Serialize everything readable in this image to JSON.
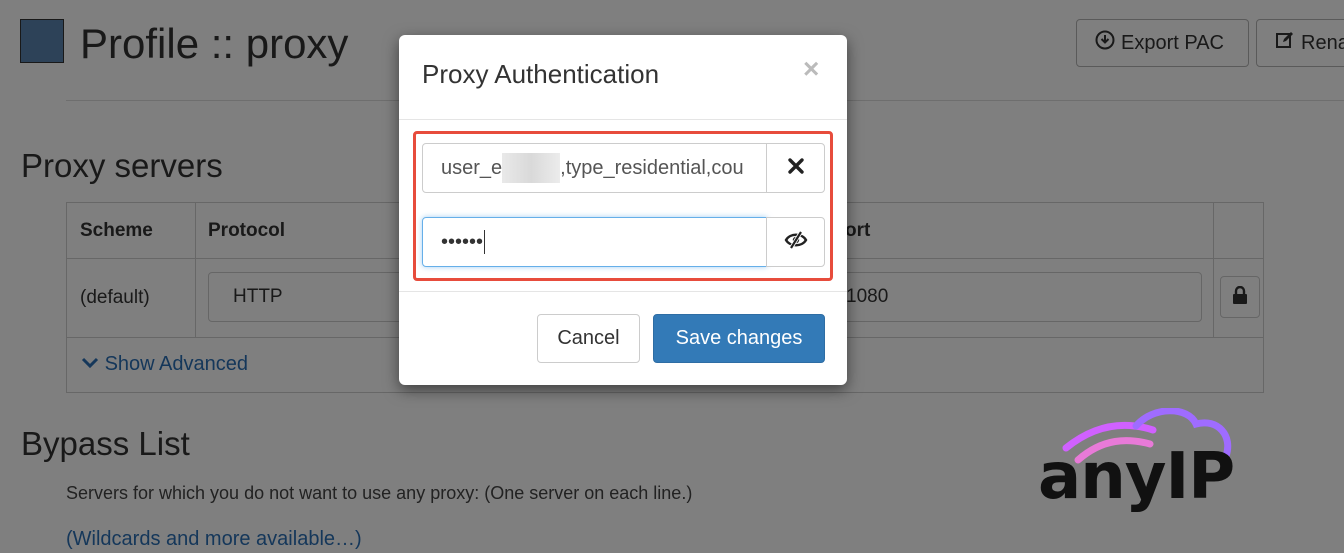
{
  "header": {
    "title": "Profile :: proxy",
    "export_pac_label": "Export PAC",
    "rename_label": "Rena",
    "swatch_color": "#5b84b1"
  },
  "proxy_servers": {
    "heading": "Proxy servers",
    "columns": [
      "Scheme",
      "Protocol",
      "ort"
    ],
    "row": {
      "scheme": "(default)",
      "protocol": "HTTP",
      "port": "1080"
    },
    "show_advanced_label": "Show Advanced"
  },
  "bypass": {
    "heading": "Bypass List",
    "description": "Servers for which you do not want to use any proxy: (One server on each line.)",
    "wildcards_link": "(Wildcards and more available…)"
  },
  "modal": {
    "title": "Proxy Authentication",
    "close_glyph": "×",
    "username_prefix": "user_e",
    "username_suffix": ",type_residential,cou",
    "password_masked": "••••••",
    "cancel_label": "Cancel",
    "save_label": "Save changes",
    "highlight_color": "#e74c3c"
  },
  "logo": {
    "text": "anyIP"
  },
  "icons": {
    "export": "download-circle-icon",
    "rename": "edit-icon",
    "clear": "close-icon",
    "toggle_visibility": "eye-slash-icon",
    "lock": "lock-icon",
    "chevron": "chevron-down-icon"
  }
}
